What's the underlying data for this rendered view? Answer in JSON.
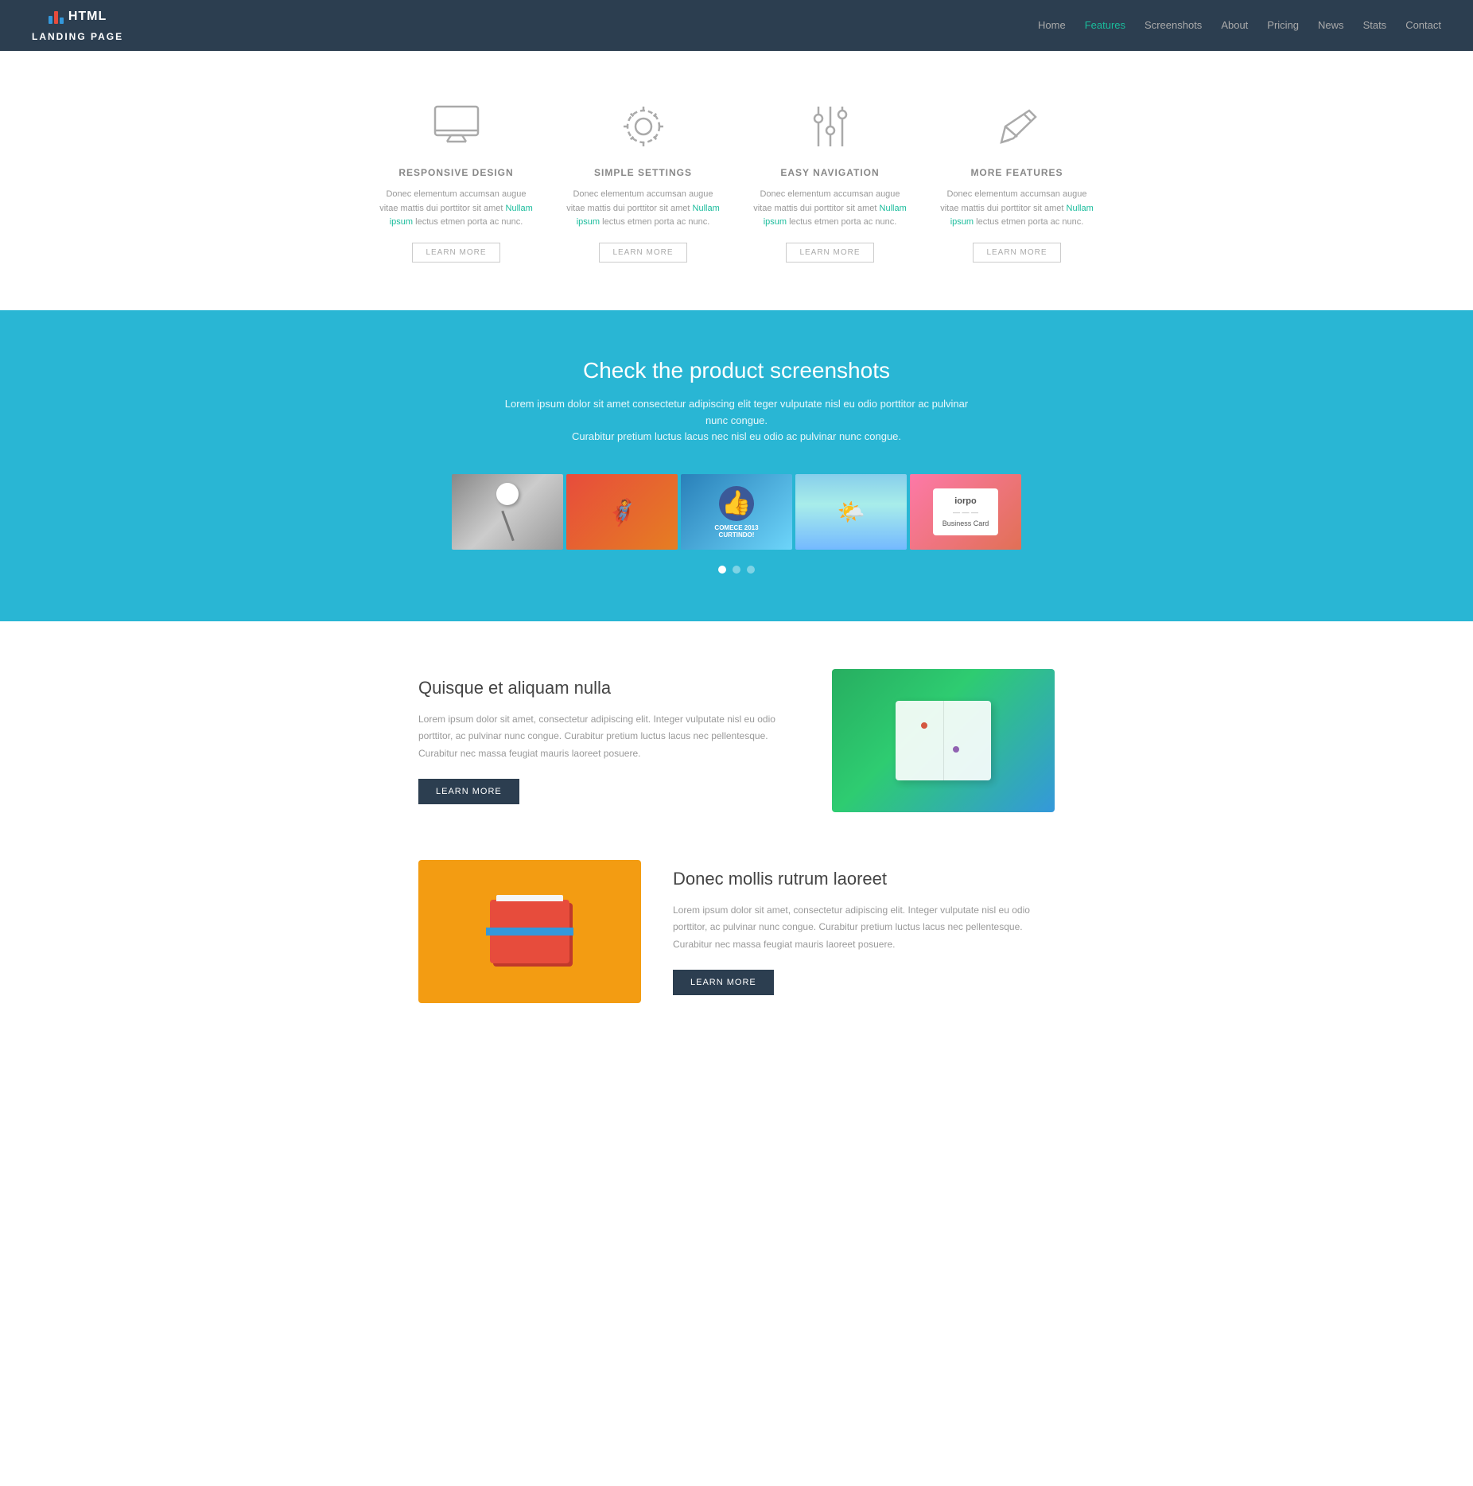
{
  "navbar": {
    "brand_bars": "icon",
    "brand_name_top": "HTML",
    "brand_name_bottom": "LANDING PAGE",
    "nav_items": [
      {
        "label": "Home",
        "href": "#",
        "active": false
      },
      {
        "label": "Features",
        "href": "#",
        "active": true
      },
      {
        "label": "Screenshots",
        "href": "#",
        "active": false
      },
      {
        "label": "About",
        "href": "#",
        "active": false
      },
      {
        "label": "Pricing",
        "href": "#",
        "active": false
      },
      {
        "label": "News",
        "href": "#",
        "active": false
      },
      {
        "label": "Stats",
        "href": "#",
        "active": false
      },
      {
        "label": "Contact",
        "href": "#",
        "active": false
      }
    ]
  },
  "features": {
    "items": [
      {
        "icon": "monitor",
        "title": "RESPONSIVE DESIGN",
        "desc": "Donec elementum accumsan augue vitae mattis dui porttitor sit amet Nullam ipsum lectus etmen porta ac nunc.",
        "btn": "LEARN MORE"
      },
      {
        "icon": "gear",
        "title": "SIMPLE SETTINGS",
        "desc": "Donec elementum accumsan augue vitae mattis dui porttitor sit amet Nullam ipsum lectus etmen porta ac nunc.",
        "btn": "LEARN MORE"
      },
      {
        "icon": "sliders",
        "title": "EASY NAVIGATION",
        "desc": "Donec elementum accumsan augue vitae mattis dui porttitor sit amet Nullam ipsum lectus etmen porta ac nunc.",
        "btn": "LEARN MORE"
      },
      {
        "icon": "pencil",
        "title": "MORE FEATURES",
        "desc": "Donec elementum accumsan augue vitae mattis dui porttitor sit amet Nullam ipsum lectus etmen porta ac nunc.",
        "btn": "LEARN MORE"
      }
    ]
  },
  "screenshots": {
    "heading": "Check the product screenshots",
    "subtext": "Lorem ipsum dolor sit amet consectetur adipiscing elit teger vulputate nisl eu odio porttitor ac pulvinar nunc congue.\nCurabitur pretium luctus lacus nec nisl eu odio ac pulvinar nunc congue.",
    "dots": [
      true,
      false,
      false
    ]
  },
  "content_blocks": [
    {
      "title": "Quisque et aliquam nulla",
      "desc": "Lorem ipsum dolor sit amet, consectetur adipiscing elit. Integer vulputate nisl eu odio porttitor, ac pulvinar nunc congue. Curabitur pretium luctus lacus nec pellentesque. Curabitur nec massa feugiat mauris laoreet posuere.",
      "btn": "LEARN MORE",
      "image_type": "map"
    },
    {
      "title": "Donec mollis rutrum laoreet",
      "desc": "Lorem ipsum dolor sit amet, consectetur adipiscing elit. Integer vulputate nisl eu odio porttitor, ac pulvinar nunc congue. Curabitur pretium luctus lacus nec pellentesque. Curabitur nec massa feugiat mauris laoreet posuere.",
      "btn": "LEARN MORE",
      "image_type": "wallet"
    }
  ]
}
